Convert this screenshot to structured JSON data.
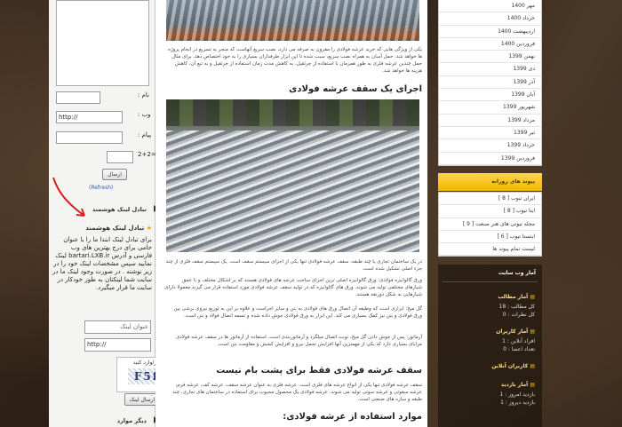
{
  "comment_form": {
    "name_label": ": نام",
    "web_label": ": وب",
    "web_value": "http://",
    "message_label": ": پیام",
    "captcha_label": "2+2=",
    "submit": "ارسال",
    "refresh": "(Refresh)"
  },
  "left": {
    "link_exchange_head": "تبادل لینک هوشمند",
    "smart_link_title": "تبادل لینک هوشمند",
    "smart_link_text": "برای تبادل لینک ابتدا ما را با عنوان حامی برای درج بهترین های وب فارسی و آدرس bartari.LXB.ir لینک نمایید سپس مشخصات لینک خود را در زیر نوشته . در صورت وجود لینک ما در سایت شما لینکتان به طور خودکار در سایت ما قرار میگیرد.",
    "link_title_placeholder": "عنوان لینک",
    "link_url_value": "http://",
    "captcha_caption": "کدزیر/وارد کنید",
    "captcha_text": "F5ff",
    "send_link": "ارسال لینک",
    "more_head": "دیگر موارد"
  },
  "main": {
    "para1": "یکی از ویژگی هایی که خرید عرشه فولادی را مقرون به صرفه می دارد، نصب سریع آنهاست که منجر به تسریع در انجام پروژه ها خواهد شد. حمل آسان به همراه نصب سریع، سبب شده تا این ابزار طرفداران بسیاری را به خود اختصاص دهد. برای مثال حمل چندین عرشه فلزی به طور همزمان با استفاده از جرثقیل، به کاهش مدت زمان استفاده از جرثقیل و به تبع آن، کاهش هزینه ها خواهد شد.",
    "heading1": "اجرای یک سقف عرشه فولادی",
    "para2": "در یک ساختمان تجاری یا چند طبقه، سقف عرشه فولادی تنها یکی از اجزای سیستم سقف است. یک سیستم سقف فلزی از چند جزء اصلی تشکیل شده است.",
    "para3": "ورق گالوانیزه فولادی: ورق گالوانیزه اصلی ترین اجزای ساخت عرشه های فولادی هستند که بر اشکال مختلف و با عمق شیارهای مختلفی تولید می شوند. ورق های گالوانیزه که در تولید سقف عرشه فولادی مورد استفاده قرار می گیرند معمولا دارای شیارهایی به شکل ذوزنقه هستند.",
    "para4": "گل میخ: ابزاری است که وظیفه آن اتصال ورق های فولادی به بتن و سایر اجزاست و علاوه بر این به توزیع نیروی برشی بین ورق فولادی و بتن نیز کمک بسیاری می کند. این ابزار به ورق فولادی جوش داده شده و تسمه اتصال فولاد و بتن است.",
    "para5": "آرماتور: پس از جوش دادن گل میخ، نوبت اتصال میلگرد و آرماتوربندی است. استفاده از آرماتور ها در سقف عرشه فولادی مزایای بسیاری دارد که یکی از مهمترین آنها افزایش تحمل نیرو و افزایش کشش و مقاومت بتن است.",
    "heading2": "سقف عرشه فولادی فقط برای پشت بام نیست",
    "para6": "سقف عرشه فولادی تنها یکی از انواع عرشه های فلزی است. عرشه فلزی به عنوان عرشه سقف، عرشه کف، عرشه فرم، عرشه سقوتی و عرشه سوتی تولید می شوند. عرشه فولادی یک محصول محبوب برای استفاده در ساختمان های تجاری، چند طبقه و سازه های صنعتی است.",
    "heading3": "موارد استفاده از عرشه فولادی:"
  },
  "archive": [
    "مهر 1400",
    "خرداد 1400",
    "اردیبهشت 1400",
    "فروردین 1400",
    "بهمن 1399",
    "دی 1399",
    "آذر 1399",
    "آبان 1399",
    "شهریور 1399",
    "مرداد 1399",
    "تیر 1399",
    "خرداد 1399",
    "فروردین 1399"
  ],
  "daily_links": {
    "head": "پیوند های روزانه",
    "items": [
      "ایران تیوب [ 8 ]",
      "ایتا تیوب [ 8 ]",
      "مجله تیوتی های هنر صنعت [ 9 ]",
      "اینستا تیوب [ 6 ]",
      "لیست تمام پیوند ها"
    ]
  },
  "stats": {
    "head": "آمار وب سایت",
    "posts_head": "آمار مطالب",
    "all_posts": "کل مطالب : 18",
    "all_comments": "کل نظرات : 0",
    "users_head": "آمار کاربران",
    "online": "افراد آنلاین : 1",
    "members": "تعداد اعضا : 0",
    "online_users_head": "کاربران آنلاین",
    "visits_head": "آمار بازدید",
    "today": "بازدید امروز : 1",
    "yesterday": "بازدید دیروز : 1"
  },
  "colors": {
    "accent": "#f0b800",
    "link": "#2c5fa8",
    "bg": "#3a2a1e"
  }
}
